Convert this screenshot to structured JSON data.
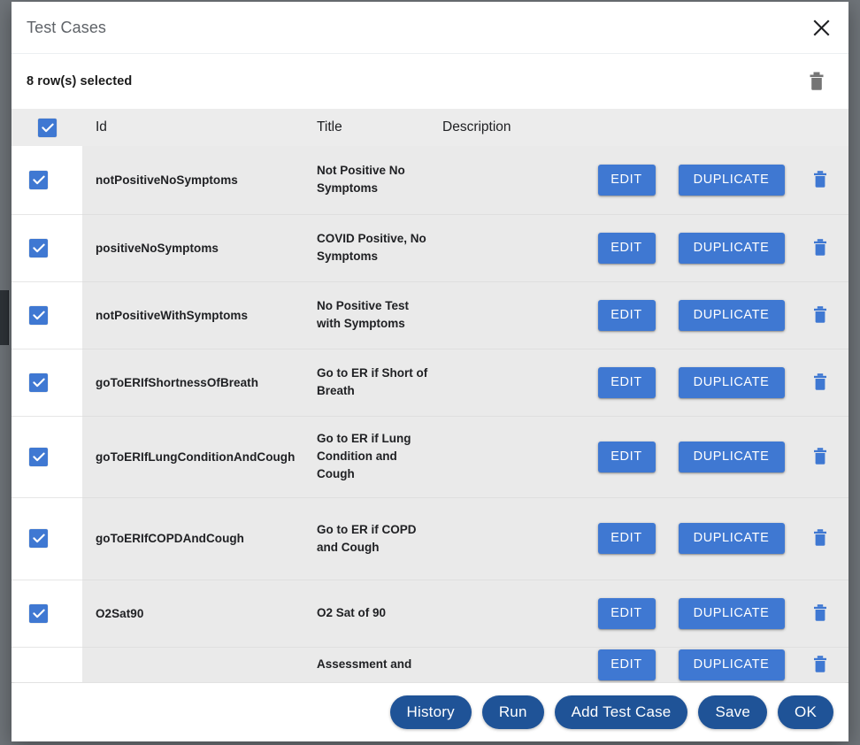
{
  "dialog": {
    "title": "Test Cases",
    "close_icon": "close-icon"
  },
  "selection": {
    "count_label": "8 row(s) selected",
    "delete_icon": "trash-icon"
  },
  "table": {
    "columns": {
      "checkbox": "",
      "id": "Id",
      "title": "Title",
      "description": "Description"
    },
    "header_checkbox_checked": true,
    "action_labels": {
      "edit": "EDIT",
      "duplicate": "DUPLICATE",
      "delete_icon": "trash-icon"
    },
    "rows": [
      {
        "checked": true,
        "id": "notPositiveNoSymptoms",
        "title": "Not Positive No Symptoms",
        "description": "",
        "edit": "EDIT",
        "duplicate": "DUPLICATE"
      },
      {
        "checked": true,
        "id": "positiveNoSymptoms",
        "title": "COVID Positive, No Symptoms",
        "description": "",
        "edit": "EDIT",
        "duplicate": "DUPLICATE"
      },
      {
        "checked": true,
        "id": "notPositiveWithSymptoms",
        "title": "No Positive Test with Symptoms",
        "description": "",
        "edit": "EDIT",
        "duplicate": "DUPLICATE"
      },
      {
        "checked": true,
        "id": "goToERIfShortnessOfBreath",
        "title": "Go to ER if Short of Breath",
        "description": "",
        "edit": "EDIT",
        "duplicate": "DUPLICATE"
      },
      {
        "checked": true,
        "id": "goToERIfLungConditionAndCough",
        "title": "Go to ER if Lung Condition and Cough",
        "description": "",
        "edit": "EDIT",
        "duplicate": "DUPLICATE"
      },
      {
        "checked": true,
        "id": "goToERIfCOPDAndCough",
        "title": "Go to ER if COPD and Cough",
        "description": "",
        "edit": "EDIT",
        "duplicate": "DUPLICATE"
      },
      {
        "checked": true,
        "id": "O2Sat90",
        "title": "O2 Sat of 90",
        "description": "",
        "edit": "EDIT",
        "duplicate": "DUPLICATE"
      },
      {
        "checked": false,
        "id": "",
        "title": "Assessment and",
        "description": "",
        "edit": "EDIT",
        "duplicate": "DUPLICATE"
      }
    ]
  },
  "footer": {
    "buttons": [
      {
        "label": "History"
      },
      {
        "label": "Run"
      },
      {
        "label": "Add Test Case"
      },
      {
        "label": "Save"
      },
      {
        "label": "OK"
      }
    ]
  },
  "colors": {
    "accent_blue": "#3f78d2",
    "footer_blue": "#1f5397",
    "row_bg": "#eaeaea",
    "header_bg": "#ececec",
    "page_backdrop": "#6f7479",
    "title_text": "#5f6368"
  }
}
